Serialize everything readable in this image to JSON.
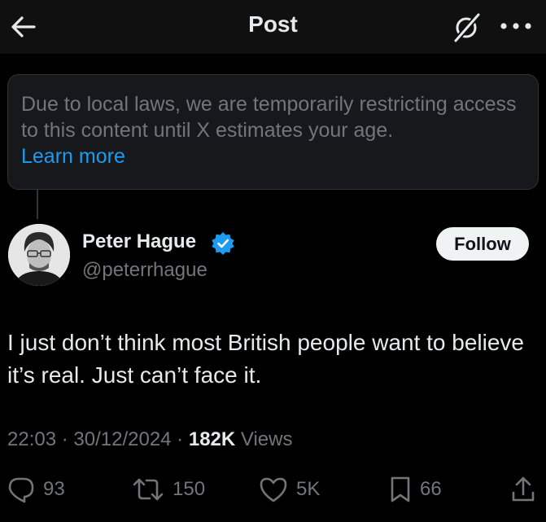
{
  "header": {
    "title": "Post"
  },
  "notice": {
    "text": "Due to local laws, we are temporarily restricting access to this content until X estimates your age.",
    "link": "Learn more"
  },
  "author": {
    "name": "Peter Hague",
    "handle": "@peterrhague",
    "verified": true
  },
  "follow_label": "Follow",
  "post": {
    "text": "I just don’t think most British people want to believe it’s real. Just can’t face it.",
    "time": "22:03",
    "date": "30/12/2024",
    "views_count": "182K",
    "views_label": "Views"
  },
  "actions": {
    "replies": "93",
    "reposts": "150",
    "likes": "5K",
    "bookmarks": "66"
  },
  "colors": {
    "background": "#000000",
    "accent": "#1d9bf0",
    "muted": "#71767b"
  },
  "icons": [
    "back-arrow-icon",
    "grok-icon",
    "more-icon",
    "verified-badge-icon",
    "reply-icon",
    "repost-icon",
    "like-icon",
    "bookmark-icon",
    "share-icon"
  ]
}
